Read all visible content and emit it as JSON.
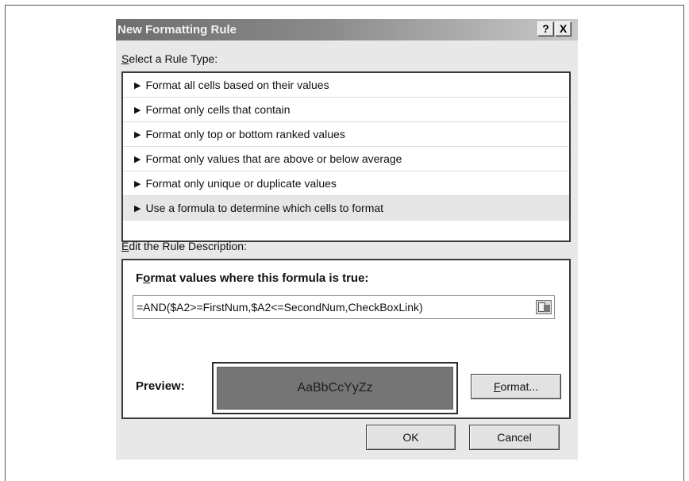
{
  "dialog": {
    "title": "New Formatting Rule",
    "help_label": "?",
    "close_label": "X"
  },
  "rule_type": {
    "label_accel": "S",
    "label_rest": "elect a Rule Type:",
    "items": [
      {
        "label": "Format all cells based on their values"
      },
      {
        "label": "Format only cells that contain"
      },
      {
        "label": "Format only top or bottom ranked values"
      },
      {
        "label": "Format only values that are above or below average"
      },
      {
        "label": "Format only unique or duplicate values"
      },
      {
        "label": "Use a formula to determine which cells to format"
      }
    ],
    "selected_index": 5,
    "arrow_icon": "triangle-right-icon"
  },
  "description": {
    "label_accel": "E",
    "label_rest": "dit the Rule Description:",
    "heading_pre": "F",
    "heading_accel": "o",
    "heading_rest": "rmat values where this formula is true:",
    "formula_value": "=AND($A2>=FirstNum,$A2<=SecondNum,CheckBoxLink)",
    "collapse_icon": "collapse-dialog-icon",
    "preview_label": "Preview:",
    "preview_sample": "AaBbCcYyZz",
    "preview_fill_color": "#757575",
    "format_button_accel": "F",
    "format_button_rest": "ormat..."
  },
  "footer": {
    "ok_label": "OK",
    "cancel_label": "Cancel"
  }
}
